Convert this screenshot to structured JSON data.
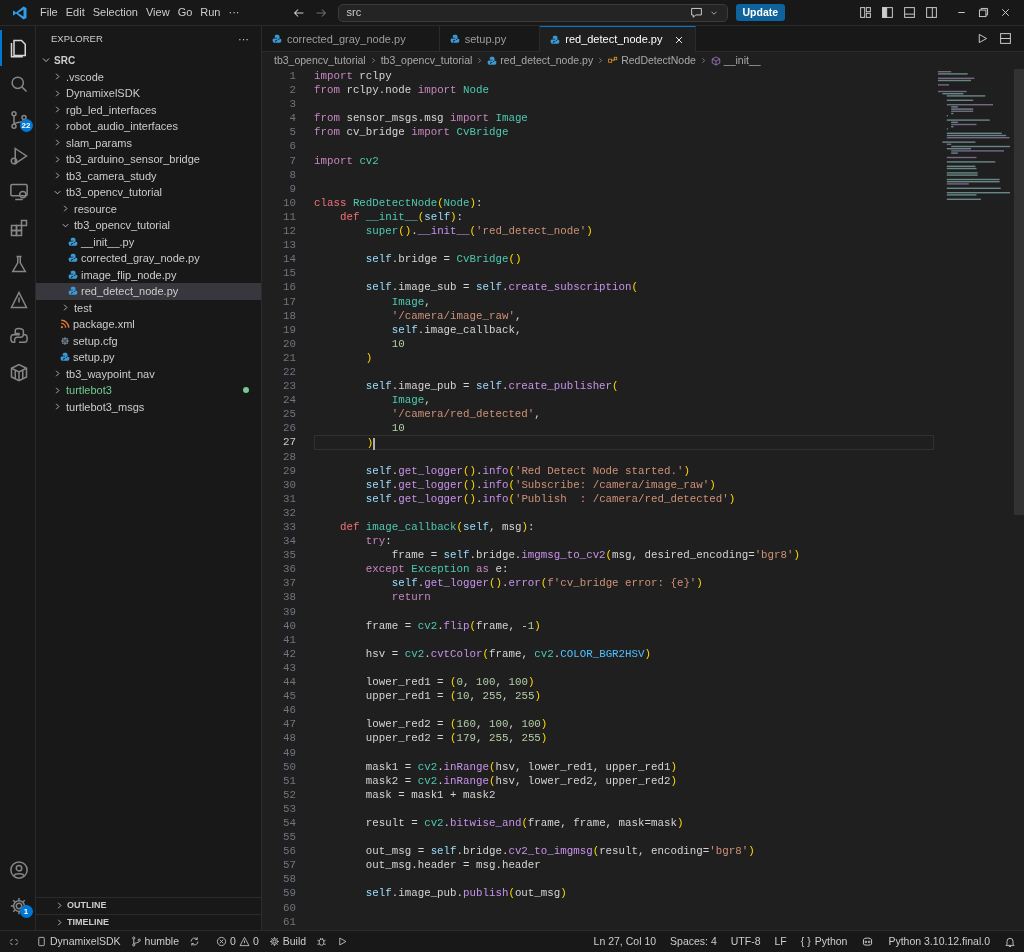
{
  "title_bar": {
    "menus": [
      "File",
      "Edit",
      "Selection",
      "View",
      "Go",
      "Run",
      "···"
    ],
    "search": {
      "value": "src"
    },
    "update_button": "Update"
  },
  "activity_bar": {
    "top": [
      {
        "selected": true
      },
      {
        "selected": false
      },
      {
        "selected": false,
        "badge": "22"
      },
      {
        "selected": false
      },
      {
        "selected": false
      },
      {
        "selected": false
      },
      {
        "selected": false
      },
      {
        "selected": false
      },
      {
        "selected": false
      },
      {
        "selected": false
      }
    ],
    "bottom": [
      {
        "selected": false
      },
      {
        "selected": false,
        "badge": "1"
      }
    ]
  },
  "sidebar": {
    "title": "EXPLORER",
    "more": "···",
    "root": {
      "label": "SRC",
      "expanded": true
    },
    "items": [
      {
        "label": ".vscode",
        "kind": "folder",
        "expanded": false,
        "selected": false,
        "git_untracked": false
      },
      {
        "label": "DynamixelSDK",
        "kind": "folder",
        "expanded": false,
        "selected": false,
        "git_untracked": false
      },
      {
        "label": "rgb_led_interfaces",
        "kind": "folder",
        "expanded": false,
        "selected": false,
        "git_untracked": false
      },
      {
        "label": "robot_audio_interfaces",
        "kind": "folder",
        "expanded": false,
        "selected": false,
        "git_untracked": false
      },
      {
        "label": "slam_params",
        "kind": "folder",
        "expanded": false,
        "selected": false,
        "git_untracked": false
      },
      {
        "label": "tb3_arduino_sensor_bridge",
        "kind": "folder",
        "expanded": false,
        "selected": false,
        "git_untracked": false
      },
      {
        "label": "tb3_camera_study",
        "kind": "folder",
        "expanded": false,
        "selected": false,
        "git_untracked": false
      },
      {
        "label": "tb3_opencv_tutorial",
        "kind": "folder",
        "expanded": true,
        "selected": false,
        "git_untracked": false,
        "children": [
          {
            "label": "resource",
            "kind": "folder",
            "expanded": false,
            "selected": false
          },
          {
            "label": "tb3_opencv_tutorial",
            "kind": "folder",
            "expanded": true,
            "selected": false,
            "children": [
              {
                "label": "__init__.py",
                "kind": "python",
                "selected": false
              },
              {
                "label": "corrected_gray_node.py",
                "kind": "python",
                "selected": false
              },
              {
                "label": "image_flip_node.py",
                "kind": "python",
                "selected": false
              },
              {
                "label": "red_detect_node.py",
                "kind": "python",
                "selected": true
              }
            ]
          },
          {
            "label": "test",
            "kind": "folder",
            "expanded": false,
            "selected": false
          },
          {
            "label": "package.xml",
            "kind": "xml",
            "selected": false
          },
          {
            "label": "setup.cfg",
            "kind": "config",
            "selected": false
          },
          {
            "label": "setup.py",
            "kind": "python",
            "selected": false
          }
        ]
      },
      {
        "label": "tb3_waypoint_nav",
        "kind": "folder",
        "expanded": false,
        "selected": false,
        "git_untracked": false
      },
      {
        "label": "turtlebot3",
        "kind": "folder",
        "expanded": false,
        "selected": false,
        "git_untracked": true
      },
      {
        "label": "turtlebot3_msgs",
        "kind": "folder",
        "expanded": false,
        "selected": false,
        "git_untracked": false
      }
    ],
    "panels": [
      {
        "label": "OUTLINE",
        "expanded": false
      },
      {
        "label": "TIMELINE",
        "expanded": false
      }
    ]
  },
  "tabs": [
    {
      "label": "corrected_gray_node.py",
      "selected": false
    },
    {
      "label": "setup.py",
      "selected": false
    },
    {
      "label": "red_detect_node.py",
      "selected": true
    }
  ],
  "breadcrumb": [
    "tb3_opencv_tutorial",
    "tb3_opencv_tutorial",
    "red_detect_node.py",
    "RedDetectNode",
    "__init__"
  ],
  "code": [
    {
      "n": "1",
      "code": "import rclpy",
      "selected": false
    },
    {
      "n": "2",
      "code": "from rclpy.node import Node",
      "selected": false
    },
    {
      "n": "3",
      "selected": false
    },
    {
      "n": "4",
      "code": "from sensor_msgs.msg import Image",
      "selected": false
    },
    {
      "n": "5",
      "code": "from cv_bridge import CvBridge",
      "selected": false
    },
    {
      "n": "6",
      "selected": false
    },
    {
      "n": "7",
      "code": "import cv2",
      "selected": false
    },
    {
      "n": "8",
      "selected": false
    },
    {
      "n": "9",
      "selected": false
    },
    {
      "n": "10",
      "code": "class RedDetectNode(Node):",
      "selected": false
    },
    {
      "n": "11",
      "code": "    def __init__(self):",
      "selected": false
    },
    {
      "n": "12",
      "code": "        super().__init__('red_detect_node')",
      "selected": false
    },
    {
      "n": "13",
      "selected": false
    },
    {
      "n": "14",
      "code": "        self.bridge = CvBridge()",
      "selected": false
    },
    {
      "n": "15",
      "selected": false
    },
    {
      "n": "16",
      "code": "        self.image_sub = self.create_subscription(",
      "selected": false
    },
    {
      "n": "17",
      "code": "            Image,",
      "selected": false
    },
    {
      "n": "18",
      "code": "            '/camera/image_raw',",
      "selected": false
    },
    {
      "n": "19",
      "code": "            self.image_callback,",
      "selected": false
    },
    {
      "n": "20",
      "code": "            10",
      "selected": false
    },
    {
      "n": "21",
      "code": "        )",
      "selected": false
    },
    {
      "n": "22",
      "selected": false
    },
    {
      "n": "23",
      "code": "        self.image_pub = self.create_publisher(",
      "selected": false
    },
    {
      "n": "24",
      "code": "            Image,",
      "selected": false
    },
    {
      "n": "25",
      "code": "            '/camera/red_detected',",
      "selected": false
    },
    {
      "n": "26",
      "code": "            10",
      "selected": false
    },
    {
      "n": "27",
      "code": "        )",
      "selected": true
    },
    {
      "n": "28",
      "selected": false
    },
    {
      "n": "29",
      "code": "        self.get_logger().info('Red Detect Node started.')",
      "selected": false
    },
    {
      "n": "30",
      "code": "        self.get_logger().info('Subscribe: /camera/image_raw')",
      "selected": false
    },
    {
      "n": "31",
      "code": "        self.get_logger().info('Publish  : /camera/red_detected')",
      "selected": false
    },
    {
      "n": "32",
      "selected": false
    },
    {
      "n": "33",
      "code": "    def image_callback(self, msg):",
      "selected": false
    },
    {
      "n": "34",
      "code": "        try:",
      "selected": false
    },
    {
      "n": "35",
      "code": "            frame = self.bridge.imgmsg_to_cv2(msg, desired_encoding='bgr8')",
      "selected": false
    },
    {
      "n": "36",
      "code": "        except Exception as e:",
      "selected": false
    },
    {
      "n": "37",
      "code": "            self.get_logger().error(f'cv_bridge error: {e}')",
      "selected": false
    },
    {
      "n": "38",
      "code": "            return",
      "selected": false
    },
    {
      "n": "39",
      "selected": false
    },
    {
      "n": "40",
      "code": "        frame = cv2.flip(frame, -1)",
      "selected": false
    },
    {
      "n": "41",
      "selected": false
    },
    {
      "n": "42",
      "code": "        hsv = cv2.cvtColor(frame, cv2.COLOR_BGR2HSV)",
      "selected": false
    },
    {
      "n": "43",
      "selected": false
    },
    {
      "n": "44",
      "code": "        lower_red1 = (0, 100, 100)",
      "selected": false
    },
    {
      "n": "45",
      "code": "        upper_red1 = (10, 255, 255)",
      "selected": false
    },
    {
      "n": "46",
      "selected": false
    },
    {
      "n": "47",
      "code": "        lower_red2 = (160, 100, 100)",
      "selected": false
    },
    {
      "n": "48",
      "code": "        upper_red2 = (179, 255, 255)",
      "selected": false
    },
    {
      "n": "49",
      "selected": false
    },
    {
      "n": "50",
      "code": "        mask1 = cv2.inRange(hsv, lower_red1, upper_red1)",
      "selected": false
    },
    {
      "n": "51",
      "code": "        mask2 = cv2.inRange(hsv, lower_red2, upper_red2)",
      "selected": false
    },
    {
      "n": "52",
      "code": "        mask = mask1 + mask2",
      "selected": false
    },
    {
      "n": "53",
      "selected": false
    },
    {
      "n": "54",
      "code": "        result = cv2.bitwise_and(frame, frame, mask=mask)",
      "selected": false
    },
    {
      "n": "55",
      "selected": false
    },
    {
      "n": "56",
      "code": "        out_msg = self.bridge.cv2_to_imgmsg(result, encoding='bgr8')",
      "selected": false
    },
    {
      "n": "57",
      "code": "        out_msg.header = msg.header",
      "selected": false
    },
    {
      "n": "58",
      "selected": false
    },
    {
      "n": "59",
      "code": "        self.image_pub.publish(out_msg)",
      "selected": false
    },
    {
      "n": "60",
      "selected": false
    },
    {
      "n": "61",
      "selected": false
    }
  ],
  "status_bar": {
    "left": [
      "DynamixelSDK",
      "humble"
    ],
    "problems": {
      "errors": "0",
      "warnings": "0"
    },
    "build": "Build",
    "right": [
      "Ln 27, Col 10",
      "Spaces: 4",
      "UTF-8",
      "LF"
    ],
    "language_icon": "{ }",
    "language": "Python",
    "interpreter": "Python 3.10.12.final.0"
  }
}
